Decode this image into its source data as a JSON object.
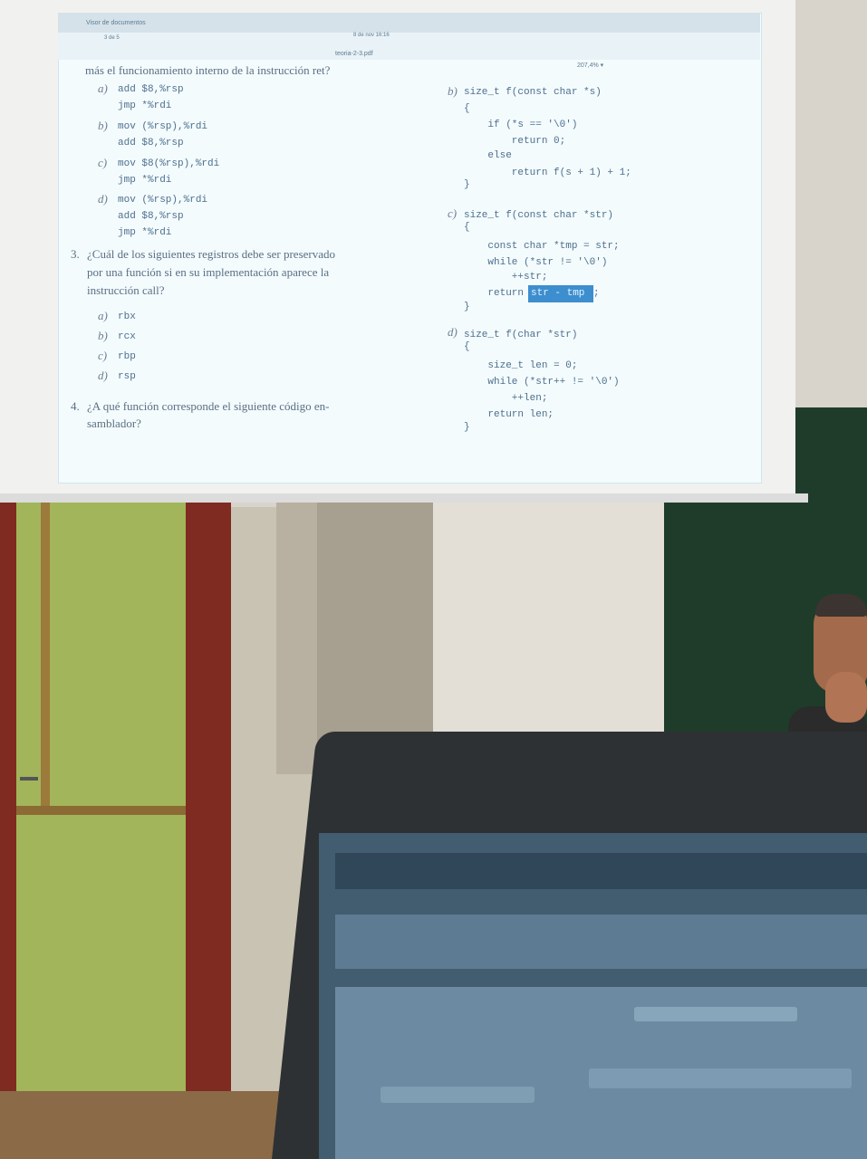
{
  "viewer": {
    "window_title": "Visor de documentos",
    "page_info": "3  de 5",
    "clock": "8 de nov  16:16",
    "document_name": "teoria-2-3.pdf",
    "zoom": "207,4% ▾"
  },
  "left_column": {
    "intro": "más el funcionamiento interno de la instrucción ret?",
    "options": [
      {
        "label": "a)",
        "lines": [
          "add $8,%rsp",
          "jmp *%rdi"
        ]
      },
      {
        "label": "b)",
        "lines": [
          "mov (%rsp),%rdi",
          "add $8,%rsp"
        ]
      },
      {
        "label": "c)",
        "lines": [
          "mov $8(%rsp),%rdi",
          "jmp *%rdi"
        ]
      },
      {
        "label": "d)",
        "lines": [
          "mov (%rsp),%rdi",
          "add $8,%rsp",
          "jmp *%rdi"
        ]
      }
    ],
    "q3": {
      "number": "3.",
      "lines": [
        "¿Cuál de los siguientes registros debe ser preservado",
        "por una función si en su implementación aparece la",
        "instrucción call?"
      ],
      "options": [
        {
          "label": "a)",
          "value": "rbx"
        },
        {
          "label": "b)",
          "value": "rcx"
        },
        {
          "label": "c)",
          "value": "rbp"
        },
        {
          "label": "d)",
          "value": "rsp"
        }
      ]
    },
    "q4": {
      "number": "4.",
      "lines": [
        "¿A qué función corresponde el siguiente código en-",
        "samblador?"
      ]
    }
  },
  "right_column": {
    "b": {
      "label": "b)",
      "lines": [
        "size_t f(const char *s)",
        "{",
        "    if (*s == '\\0')",
        "        return 0;",
        "    else",
        "        return f(s + 1) + 1;",
        "}"
      ]
    },
    "c": {
      "label": "c)",
      "lines": [
        "size_t f(const char *str)",
        "{",
        "    const char *tmp = str;",
        "    while (*str != '\\0')",
        "        ++str;",
        "    return ",
        "}"
      ],
      "highlight": "str - tmp",
      "after": ";"
    },
    "d": {
      "label": "d)",
      "lines": [
        "size_t f(char *str)",
        "{",
        "    size_t len = 0;",
        "    while (*str++ != '\\0')",
        "        ++len;",
        "    return len;",
        "}"
      ]
    }
  }
}
